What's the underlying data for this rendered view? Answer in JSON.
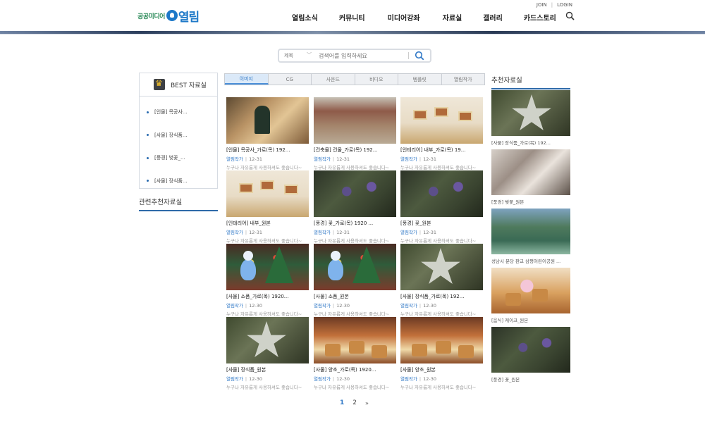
{
  "header": {
    "logo_small": "공공미디어",
    "logo_big": "열림",
    "top_links": [
      "JOIN",
      "LOGIN"
    ],
    "nav": [
      "열림소식",
      "커뮤니티",
      "미디어강좌",
      "자료실",
      "갤러리",
      "카드스토리"
    ]
  },
  "search": {
    "select_value": "제목",
    "placeholder": "검색어를 입력하세요"
  },
  "best": {
    "title": "BEST 자료실",
    "items": [
      "[인물] 목공사...",
      "[사물] 장식품...",
      "[풍경] 벚꽃_...",
      "[사물] 장식품..."
    ]
  },
  "related_title": "관련추천자료실",
  "tabs": [
    "이미지",
    "CG",
    "사운드",
    "비디오",
    "템플릿",
    "열림작가"
  ],
  "grid": [
    {
      "title": "[인물] 목공사_가로(목) 192...",
      "author": "열림작가",
      "date": "12-31",
      "desc": "누구나 자유롭게 사용하셔도 좋습니다~",
      "image": "wood"
    },
    {
      "title": "[건축물] 건물_가로(목) 192...",
      "author": "열림작가",
      "date": "12-31",
      "desc": "누구나 자유롭게 사용하셔도 좋습니다~",
      "image": "street"
    },
    {
      "title": "[인테리어] 내부_가로(목) 19...",
      "author": "열림작가",
      "date": "12-31",
      "desc": "누구나 자유롭게 사용하셔도 좋습니다~",
      "image": "gallery"
    },
    {
      "title": "[인테리어] 내부_원본",
      "author": "열림작가",
      "date": "12-31",
      "desc": "누구나 자유롭게 사용하셔도 좋습니다~",
      "image": "gallery"
    },
    {
      "title": "[풍경] 꽃_가로(목) 1920 ...",
      "author": "열림작가",
      "date": "12-31",
      "desc": "누구나 자유롭게 사용하셔도 좋습니다~",
      "image": "flower"
    },
    {
      "title": "[풍경] 꽃_원본",
      "author": "열림작가",
      "date": "12-31",
      "desc": "누구나 자유롭게 사용하셔도 좋습니다~",
      "image": "flower"
    },
    {
      "title": "[사물] 소품_가로(목) 1920...",
      "author": "열림작가",
      "date": "12-30",
      "desc": "누구나 자유롭게 사용하셔도 좋습니다~",
      "image": "xmas"
    },
    {
      "title": "[사물] 소품_원본",
      "author": "열림작가",
      "date": "12-30",
      "desc": "누구나 자유롭게 사용하셔도 좋습니다~",
      "image": "xmas"
    },
    {
      "title": "[사물] 장식품_가로(목) 192...",
      "author": "열림작가",
      "date": "12-30",
      "desc": "누구나 자유롭게 사용하셔도 좋습니다~",
      "image": "star"
    },
    {
      "title": "[사물] 장식품_원본",
      "author": "열림작가",
      "date": "12-30",
      "desc": "누구나 자유롭게 사용하셔도 좋습니다~",
      "image": "star"
    },
    {
      "title": "[사물] 양초_가로(목) 1920...",
      "author": "열림작가",
      "date": "12-30",
      "desc": "누구나 자유롭게 사용하셔도 좋습니다~",
      "image": "food"
    },
    {
      "title": "[사물] 양초_원본",
      "author": "열림작가",
      "date": "12-30",
      "desc": "누구나 자유롭게 사용하셔도 좋습니다~",
      "image": "food"
    }
  ],
  "recommended": {
    "title": "추천자료실",
    "items": [
      {
        "label": "[사물] 장식품_가로(목) 192...",
        "image": "star"
      },
      {
        "label": "[풍경] 벚꽃_원본",
        "image": "blossom"
      },
      {
        "label": "성남시 분당 판교 삼평어린이공원 ...",
        "image": "city"
      },
      {
        "label": "[음식] 케이크_원본",
        "image": "cake"
      },
      {
        "label": "[풍경] 꽃_원본",
        "image": "flower"
      }
    ]
  },
  "pagination": {
    "pages": [
      "1",
      "2"
    ],
    "current": "1",
    "next": "»"
  },
  "colors": {
    "accent": "#2e77c6",
    "section_underline": "#2e6aa8",
    "logo_blue": "#1e79c8",
    "logo_green": "#2d8b5a"
  }
}
